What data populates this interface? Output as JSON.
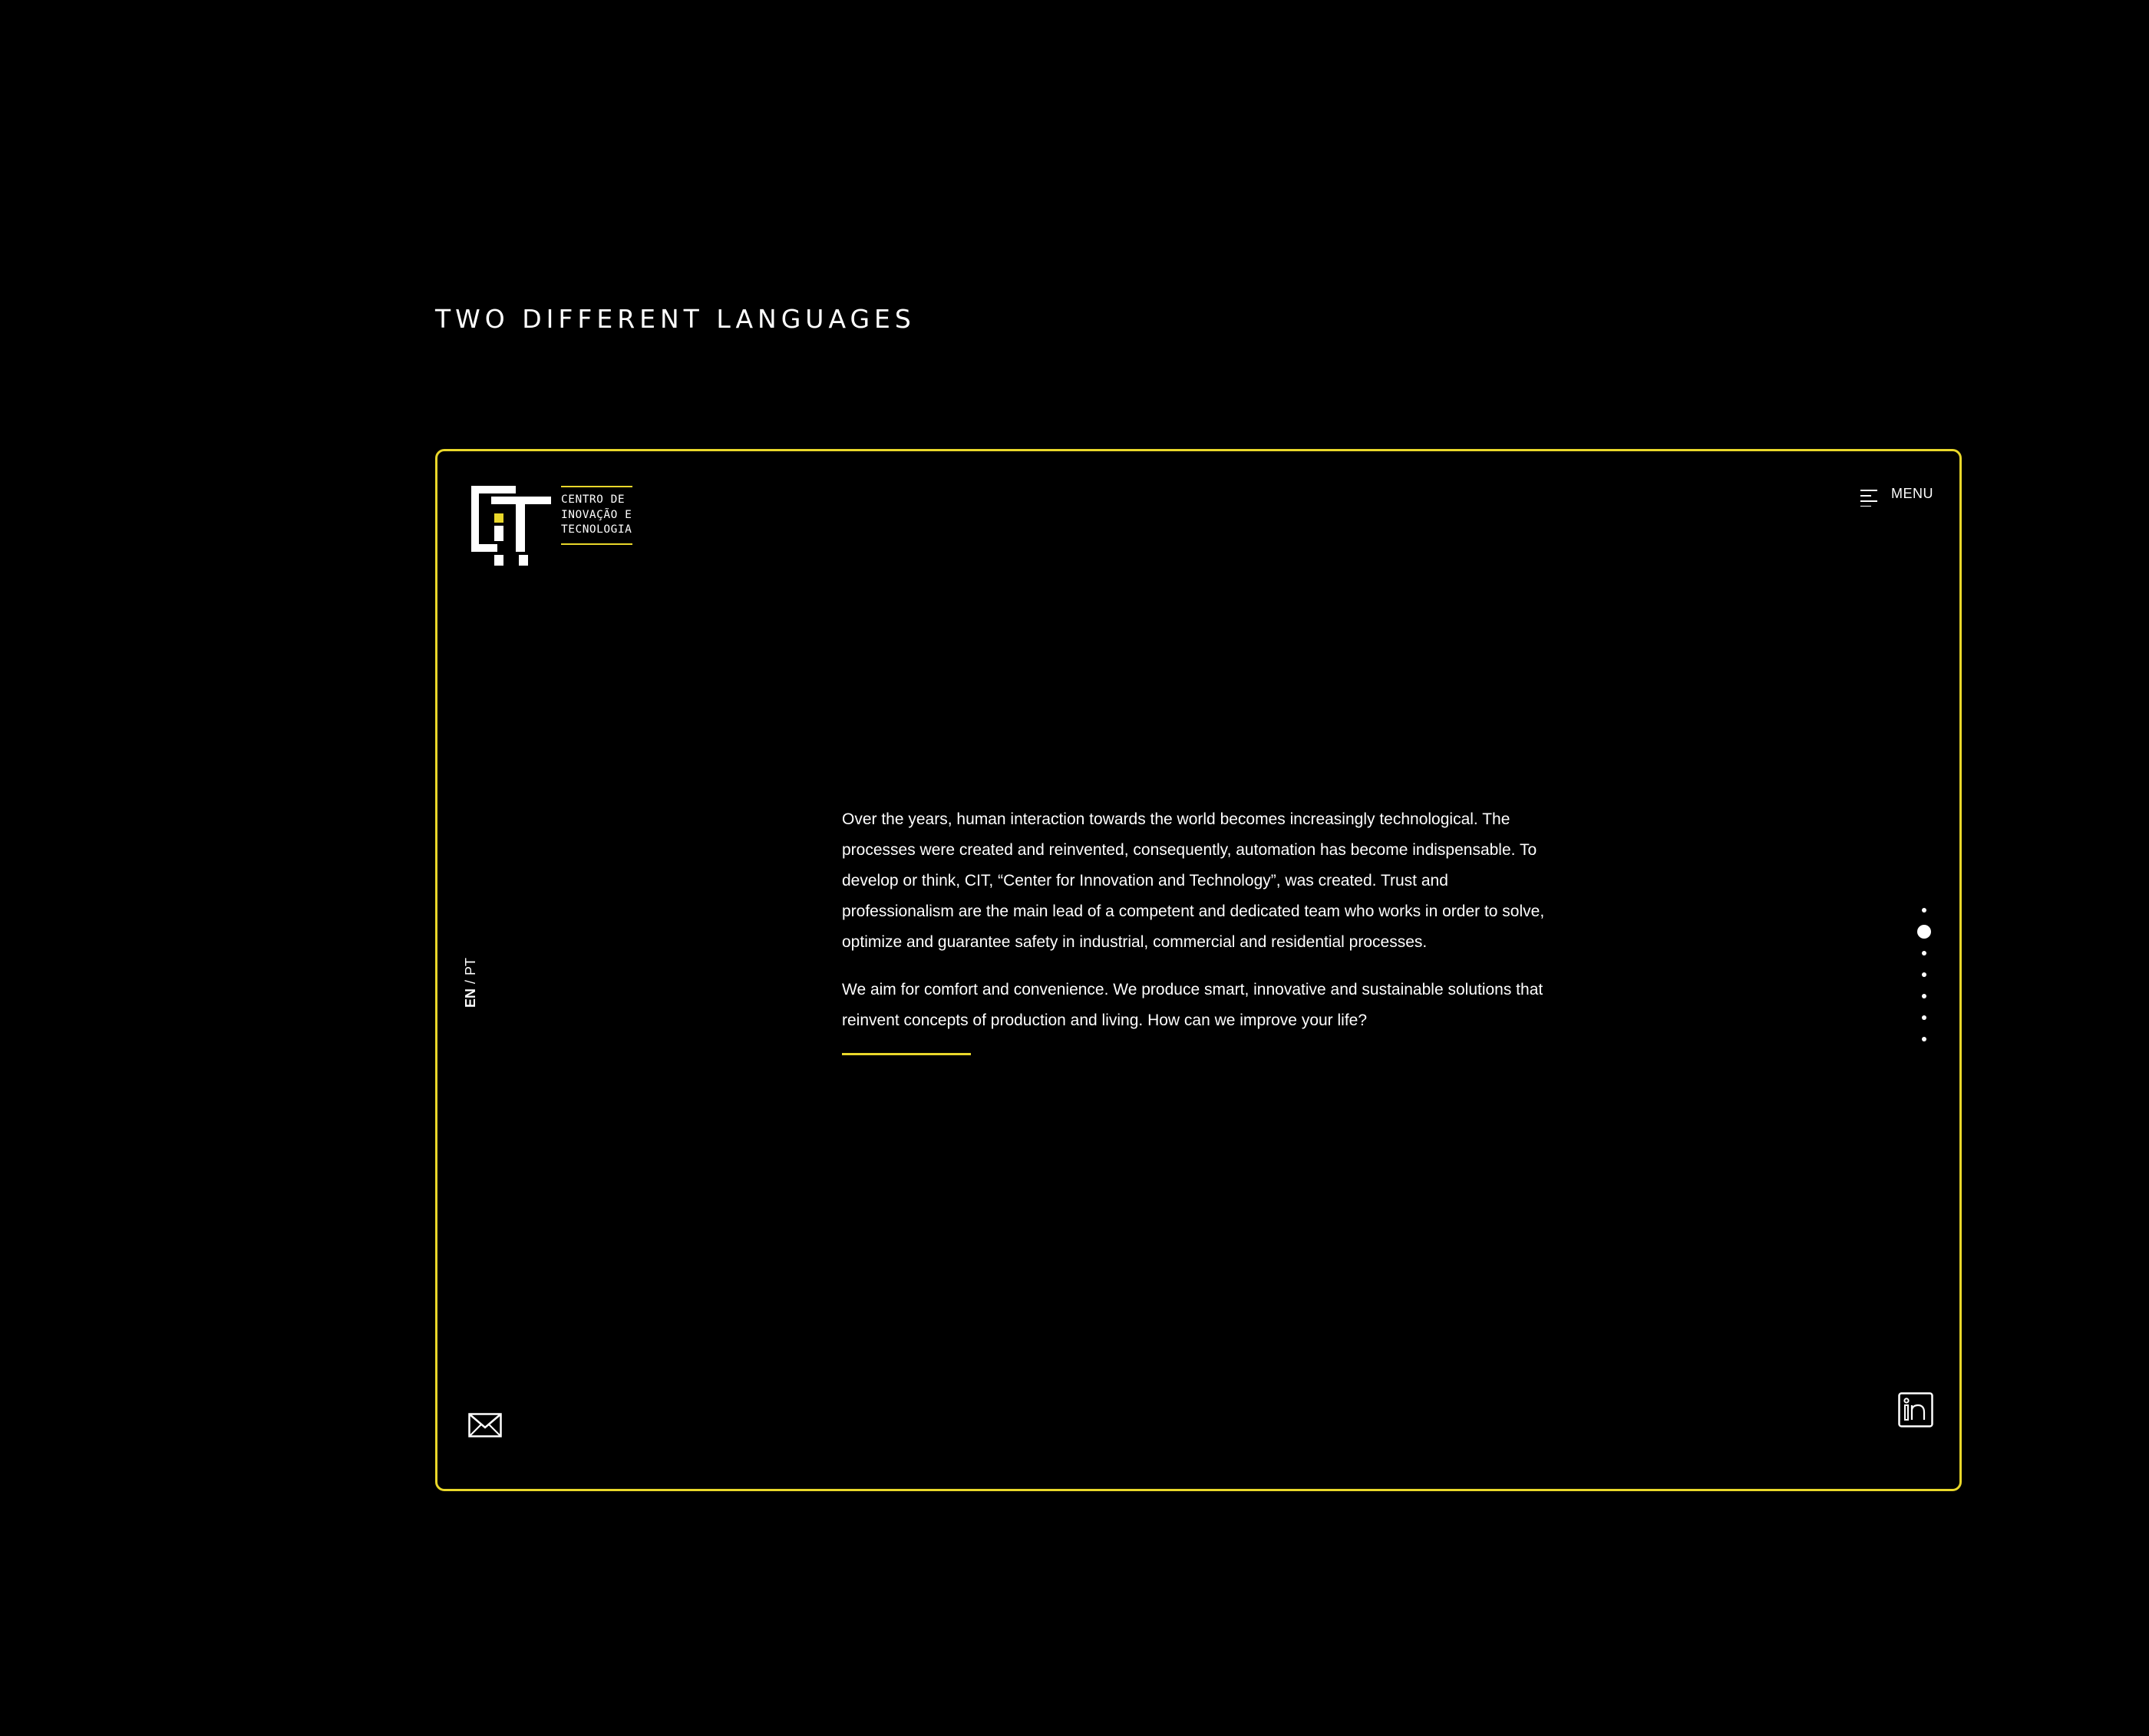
{
  "heading": "TWO DIFFERENT LANGUAGES",
  "colors": {
    "accent": "#e9d72a",
    "background": "#000000",
    "text": "#ffffff"
  },
  "logo": {
    "icon": "cit-logo-icon",
    "lines": [
      "CENTRO DE",
      "INOVAÇÃO E",
      "TECNOLOGIA"
    ]
  },
  "menu": {
    "icon": "menu-icon",
    "label": "MENU"
  },
  "language": {
    "en": "EN",
    "separator": "/",
    "pt": "PT",
    "active": "EN"
  },
  "content": {
    "paragraph_1": "Over the years, human interaction towards the world becomes increasingly technological. The processes were created and reinvented, consequently, automation has become indispensable. To develop or think, CIT, “Center for Innovation and Technology”, was created. Trust and professionalism are the main lead of a competent and dedicated team who works in order to solve, optimize and guarantee safety in industrial, commercial and residential processes.",
    "paragraph_2": "We aim for comfort and convenience. We produce smart, innovative and sustainable solutions that reinvent concepts of production and living. How can we improve your life?"
  },
  "pagination": {
    "total": 7,
    "active_index": 2
  },
  "footer": {
    "mail_icon": "mail-icon",
    "linkedin_icon": "linkedin-icon"
  }
}
